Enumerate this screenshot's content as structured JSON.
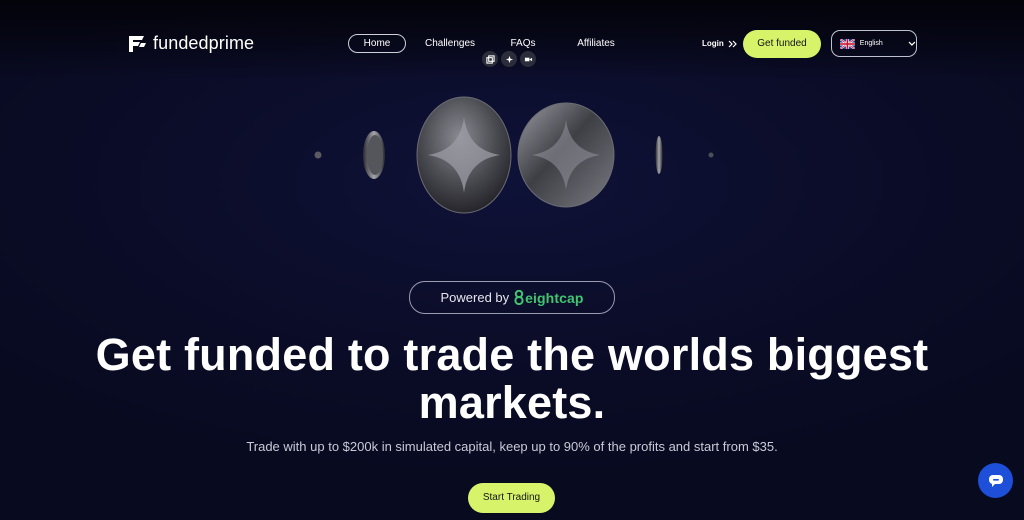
{
  "brand": {
    "name": "fundedprime"
  },
  "nav": {
    "items": [
      {
        "label": "Home",
        "active": true
      },
      {
        "label": "Challenges"
      },
      {
        "label": "FAQs"
      },
      {
        "label": "Affiliates"
      }
    ],
    "login_label": "Login",
    "cta_label": "Get funded",
    "language": "English"
  },
  "overlay_tools": [
    "copy-icon",
    "sparkle-icon",
    "video-icon"
  ],
  "hero": {
    "powered_by_label": "Powered by",
    "partner_name": "eightcap",
    "headline_line1": "Get funded to trade the worlds biggest",
    "headline_line2": "markets.",
    "subtitle": "Trade with up to $200k in simulated capital, keep up to 90% of the profits and start from $35.",
    "cta_label": "Start Trading"
  },
  "colors": {
    "accent": "#d6f36a",
    "background": "#0b0d2a",
    "partner_green": "#41c56f",
    "chat_blue": "#1d4fd8"
  },
  "chat_widget": {
    "icon": "chat-bubble-icon"
  }
}
